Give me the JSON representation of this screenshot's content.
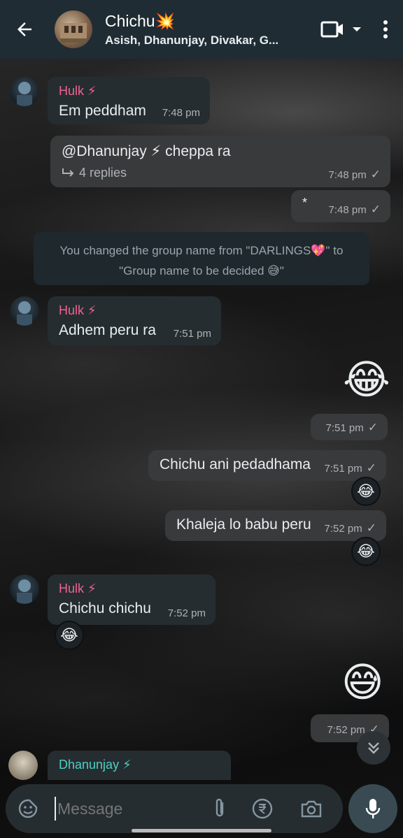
{
  "header": {
    "title": "Chichu💥",
    "subtitle": "Asish, Dhanunjay, Divakar, G..."
  },
  "messages": [
    {
      "sender": "Hulk ⚡",
      "text": "Em peddham",
      "time": "7:48 pm"
    },
    {
      "mention": "@Dhanunjay ⚡",
      "text": "cheppa ra",
      "replies": "4 replies",
      "time": "7:48 pm"
    },
    {
      "text": "*",
      "time": "7:48 pm"
    },
    {
      "sender": "Hulk ⚡",
      "text": "Adhem peru ra",
      "time": "7:51 pm"
    },
    {
      "emoji": "😂",
      "time": "7:51 pm"
    },
    {
      "text": "Chichu ani pedadhama",
      "time": "7:51 pm",
      "reaction": "😂"
    },
    {
      "text": "Khaleja lo babu peru",
      "time": "7:52 pm",
      "reaction": "😂"
    },
    {
      "sender": "Hulk ⚡",
      "text": "Chichu chichu",
      "time": "7:52 pm",
      "reaction": "😂"
    },
    {
      "emoji": "😅",
      "time": "7:52 pm"
    },
    {
      "sender": "Dhanunjay ⚡"
    }
  ],
  "system_message": {
    "line1": "You changed the group name from \"DARLINGS💖\" to",
    "line2": "\"Group name to be decided 😅\""
  },
  "composer": {
    "placeholder": "Message"
  },
  "colors": {
    "header_bg": "#1f2c33",
    "incoming_bubble": "#262d31",
    "outgoing_bubble": "#383a3b",
    "hulk_name": "#f06292",
    "dhanunjay_name": "#4dd0c4"
  }
}
